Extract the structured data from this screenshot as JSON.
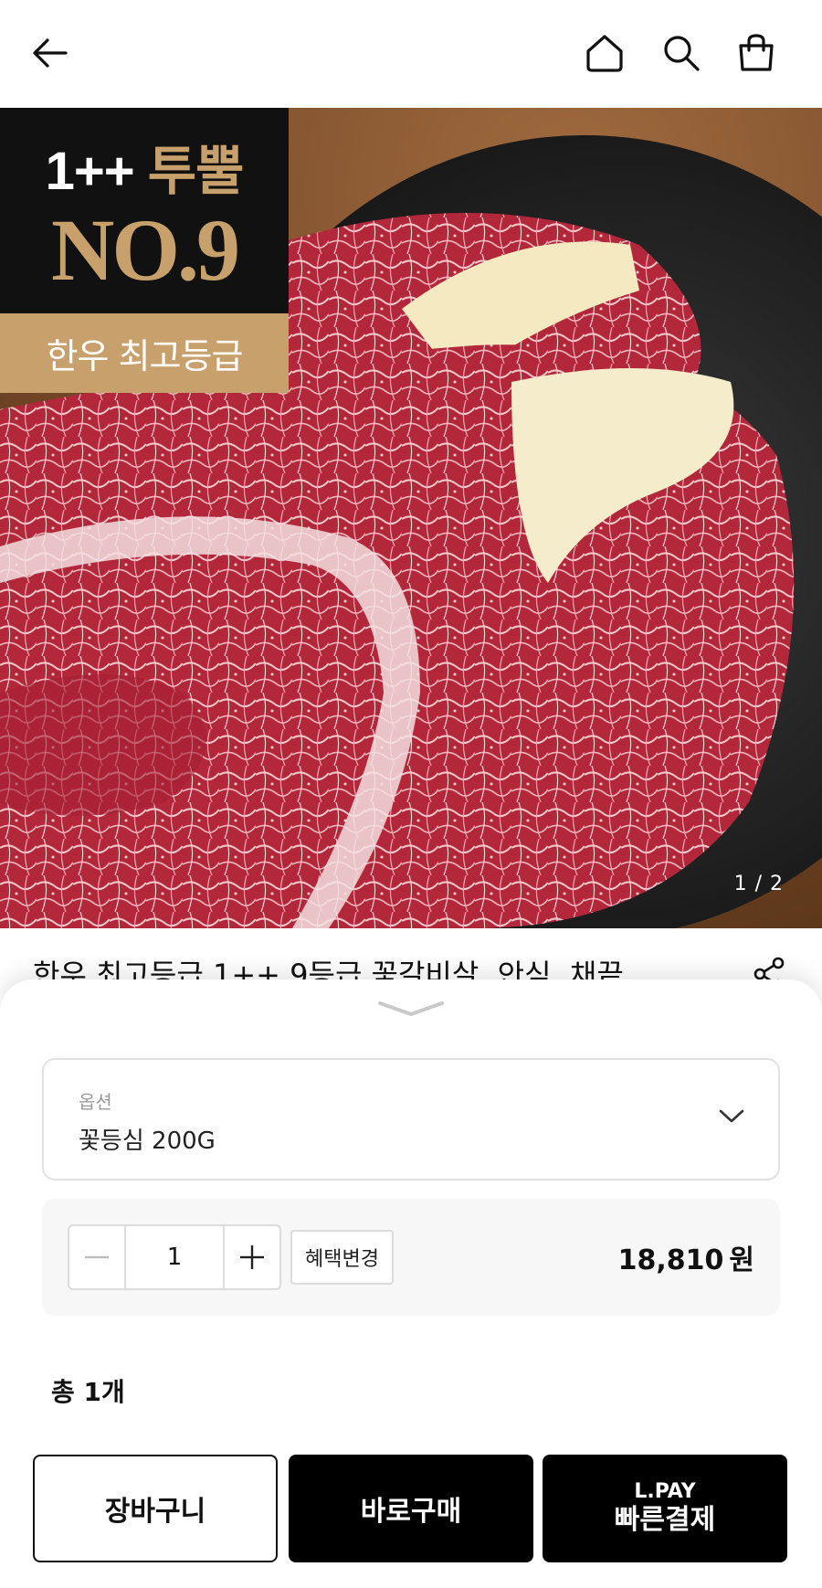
{
  "nav": {
    "icons": [
      "back-arrow-icon",
      "home-icon",
      "search-icon",
      "shopping-bag-icon"
    ]
  },
  "hero": {
    "badge_line1_a": "1++",
    "badge_line1_b": "투뿔",
    "badge_line2": "NO.9",
    "badge_sub": "한우 최고등급",
    "pager": "1 / 2"
  },
  "product": {
    "title": "한우 최고등급 1++ 9등급 꽃갈비살, 안심, 채끝"
  },
  "sheet": {
    "option_label": "옵션",
    "option_value": "꽃등심 200G",
    "quantity": "1",
    "benefit_button": "혜택변경",
    "price": "18,810",
    "currency": "원",
    "total": "총 1개"
  },
  "buttons": {
    "cart": "장바구니",
    "buy_now": "바로구매",
    "lpay_line1": "L.PAY",
    "lpay_line2": "빠른결제"
  },
  "colors": {
    "gold": "#c8a06b",
    "black": "#000000"
  }
}
